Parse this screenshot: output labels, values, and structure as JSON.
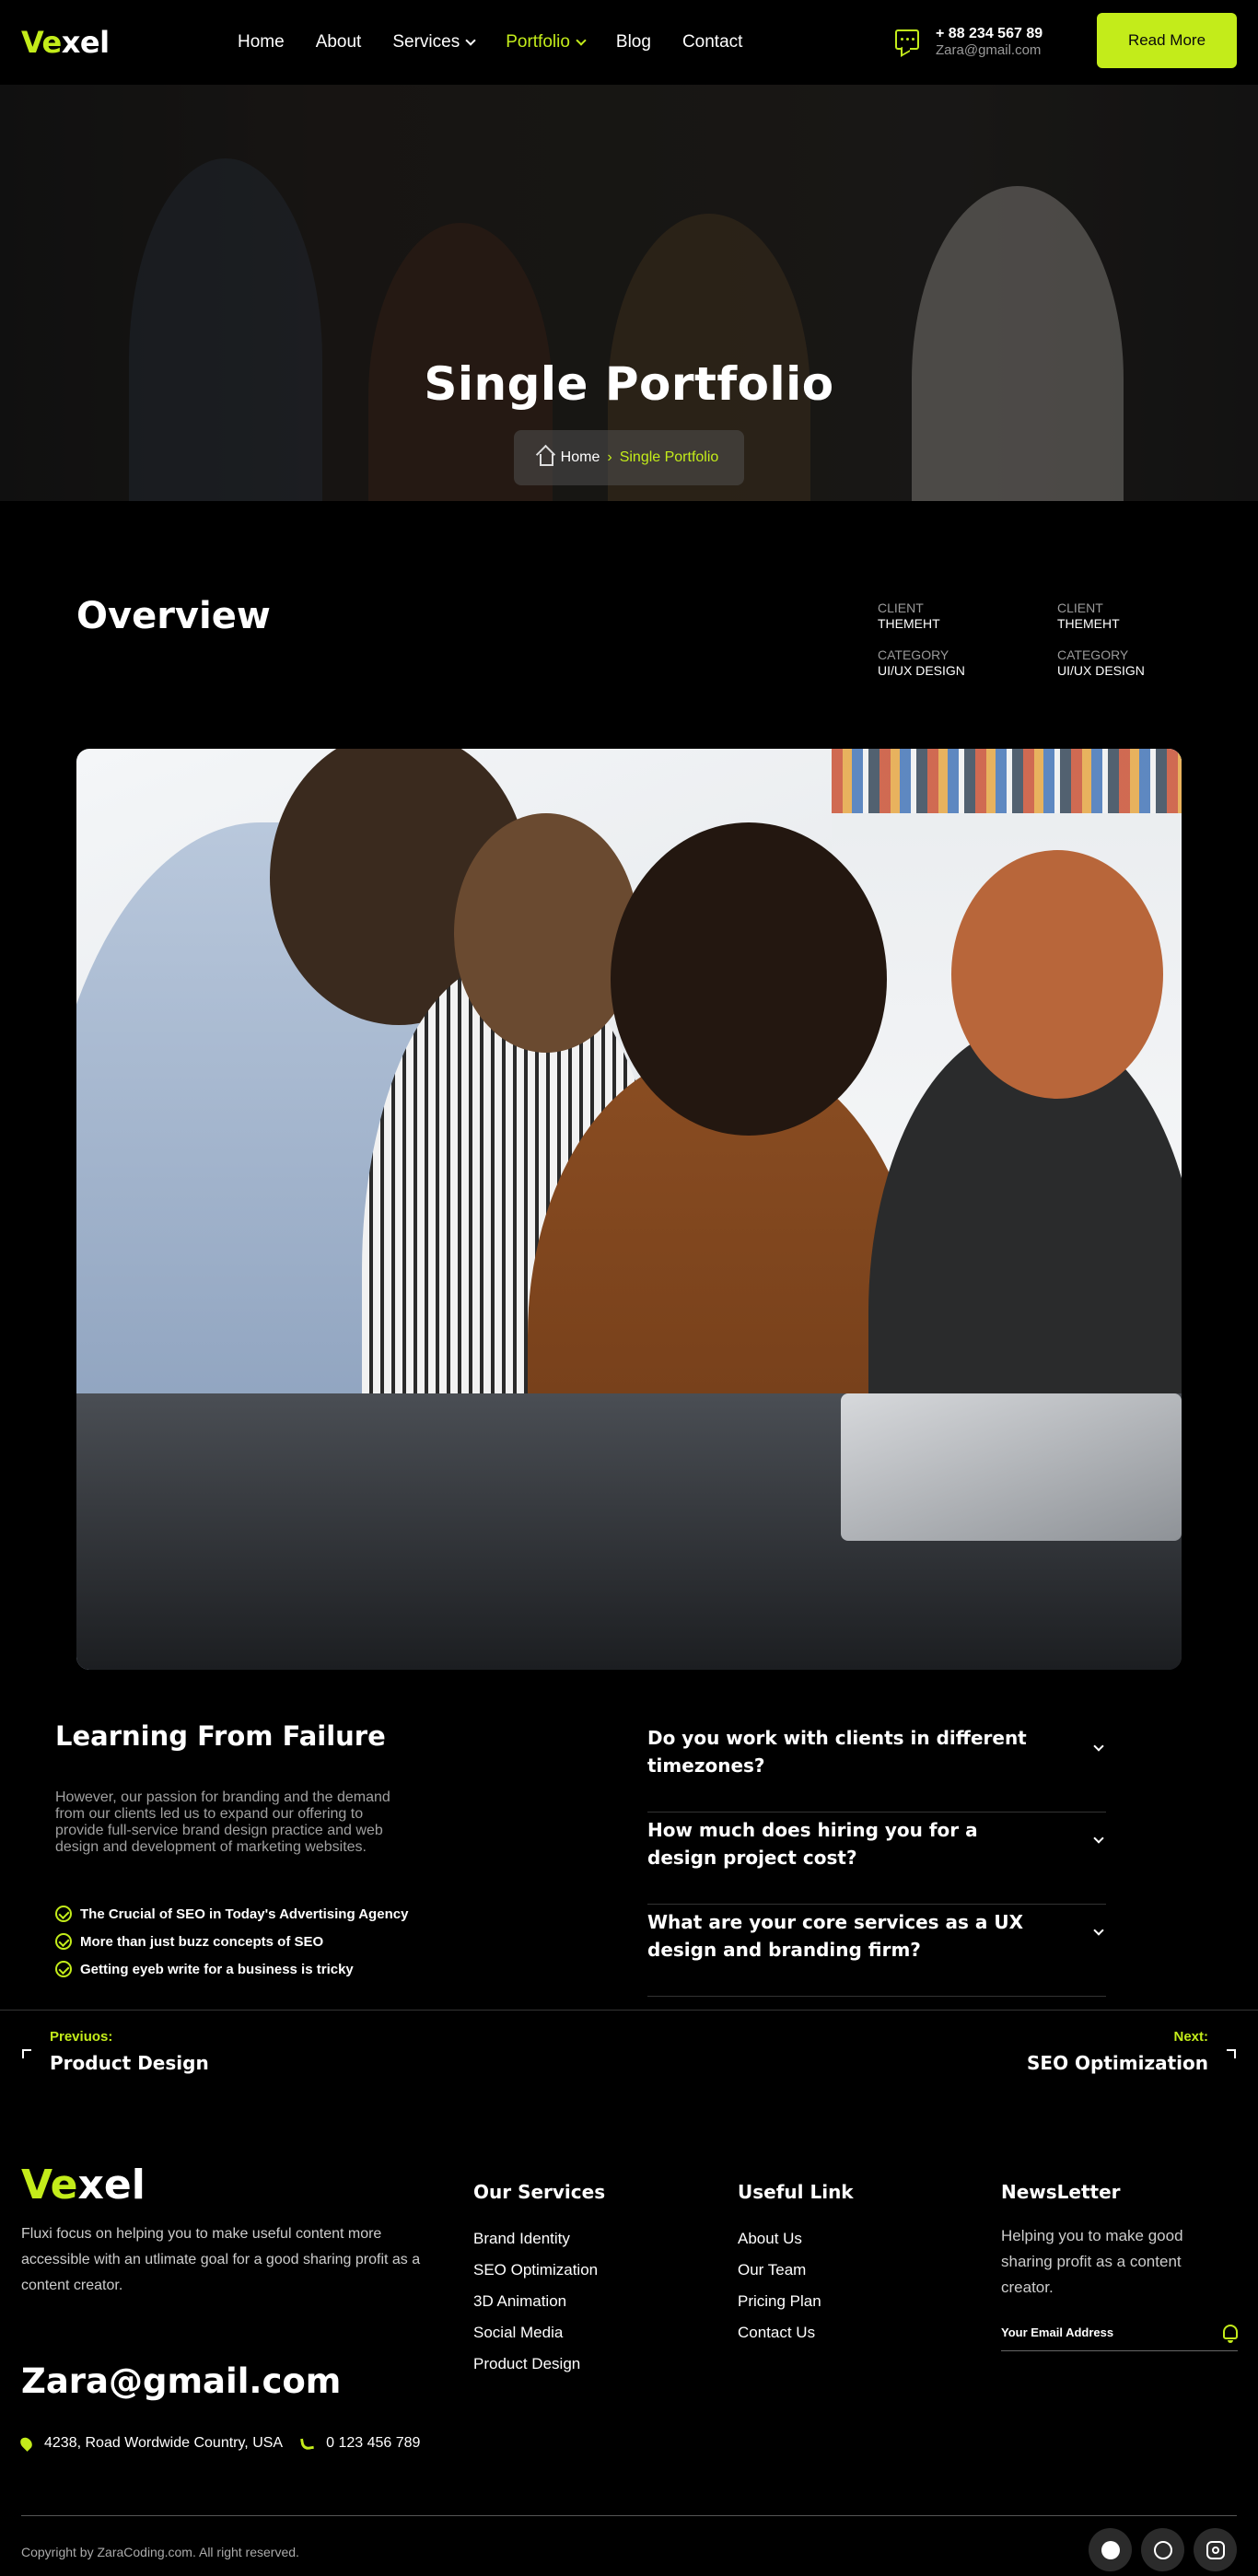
{
  "header": {
    "logo_accent": "Ve",
    "logo_rest": "xel",
    "nav": [
      {
        "label": "Home",
        "dropdown": false,
        "active": false
      },
      {
        "label": "About",
        "dropdown": false,
        "active": false
      },
      {
        "label": "Services",
        "dropdown": true,
        "active": false
      },
      {
        "label": "Portfolio",
        "dropdown": true,
        "active": true
      },
      {
        "label": "Blog",
        "dropdown": false,
        "active": false
      },
      {
        "label": "Contact",
        "dropdown": false,
        "active": false
      }
    ],
    "phone": "+ 88 234 567 89",
    "email": "Zara@gmail.com",
    "cta": "Read More"
  },
  "hero": {
    "title": "Single Portfolio",
    "breadcrumb_home": "Home",
    "breadcrumb_current": "Single Portfolio"
  },
  "overview": {
    "title": "Overview",
    "meta": [
      {
        "client_label": "CLIENT",
        "client_value": "THEMEHT",
        "category_label": "CATEGORY",
        "category_value": "UI/UX DESIGN"
      },
      {
        "client_label": "CLIENT",
        "client_value": "THEMEHT",
        "category_label": "CATEGORY",
        "category_value": "UI/UX DESIGN"
      }
    ]
  },
  "learning": {
    "title": "Learning From Failure",
    "text": "However, our passion for branding and the demand from our clients led us to expand our offering to provide full-service brand design practice and web design and development of marketing websites.",
    "checks": [
      "The Crucial of SEO in Today's Advertising Agency",
      "More than just buzz concepts of SEO",
      "Getting eyeb write for a business is tricky"
    ]
  },
  "faq": [
    "Do you work with clients in different timezones?",
    "How much does hiring you for a design project cost?",
    "What are your core services as a UX design and branding firm?"
  ],
  "pagination": {
    "prev_label": "Previuos:",
    "prev_title": "Product Design",
    "next_label": "Next:",
    "next_title": "SEO Optimization"
  },
  "footer": {
    "logo_accent": "Ve",
    "logo_rest": "xel",
    "about": "Fluxi focus on helping you to make useful content more accessible with an utlimate goal for a good sharing profit as a content creator.",
    "email": "Zara@gmail.com",
    "address": "4238, Road Wordwide Country, USA",
    "phone": "0 123 456 789",
    "services_title": "Our Services",
    "services": [
      "Brand Identity",
      "SEO Optimization",
      "3D Animation",
      "Social Media",
      "Product Design"
    ],
    "useful_title": "Useful Link",
    "useful": [
      "About Us",
      "Our Team",
      "Pricing Plan",
      "Contact Us"
    ],
    "news_title": "NewsLetter",
    "news_text": "Helping you to make  good sharing profit as a content creator.",
    "news_placeholder": "Your Email Address",
    "copyright": "Copyright by ZaraCoding.com. All right reserved.",
    "socials": [
      "facebook-icon",
      "dribbble-icon",
      "instagram-icon"
    ]
  },
  "colors": {
    "accent": "#c3ec1a",
    "background": "#000000"
  }
}
